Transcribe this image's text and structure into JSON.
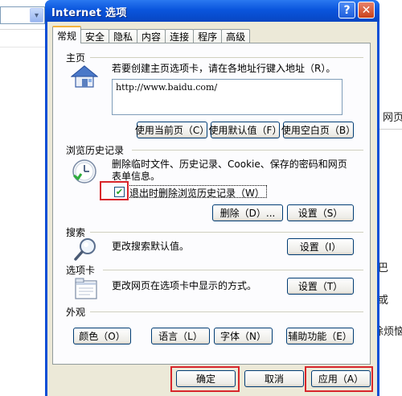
{
  "dialog": {
    "title": "Internet 选项",
    "help_glyph": "?",
    "close_glyph": "✕"
  },
  "tabs": [
    {
      "label": "常规",
      "active": true
    },
    {
      "label": "安全",
      "active": false
    },
    {
      "label": "隐私",
      "active": false
    },
    {
      "label": "内容",
      "active": false
    },
    {
      "label": "连接",
      "active": false
    },
    {
      "label": "程序",
      "active": false
    },
    {
      "label": "高级",
      "active": false
    }
  ],
  "homepage": {
    "section_label": "主页",
    "icon": "house-icon",
    "description": "若要创建主页选项卡，请在各地址行键入地址（R）。",
    "url": "http://www.baidu.com/",
    "buttons": [
      "使用当前页（C）",
      "使用默认值（F）",
      "使用空白页（B）"
    ]
  },
  "history": {
    "section_label": "浏览历史记录",
    "icon": "history-clock-icon",
    "description_line1": "删除临时文件、历史记录、Cookie、保存的密码和网页",
    "description_line2": "表单信息。",
    "checkbox_checked": true,
    "checkbox_label": "退出时删除浏览历史记录（W）",
    "delete_button": "删除（D）...",
    "settings_button": "设置（S）"
  },
  "search": {
    "section_label": "搜索",
    "icon": "magnifier-icon",
    "description": "更改搜索默认值。",
    "settings_button": "设置（I）"
  },
  "tabs_section": {
    "section_label": "选项卡",
    "icon": "tab-window-icon",
    "description": "更改网页在选项卡中显示的方式。",
    "settings_button": "设置（T）"
  },
  "appearance": {
    "section_label": "外观",
    "buttons": [
      "颜色（O）",
      "语言（L）",
      "字体（N）",
      "辅助功能（E）"
    ]
  },
  "footer": {
    "ok": "确定",
    "cancel": "取消",
    "apply": "应用（A）"
  },
  "background": {
    "right_texts": [
      "网页",
      "巴",
      "或",
      "除烦恼"
    ],
    "combo_arrow": "▾"
  },
  "colors": {
    "highlight_box": "#d8262b",
    "titlebar": "#0a55dd"
  }
}
